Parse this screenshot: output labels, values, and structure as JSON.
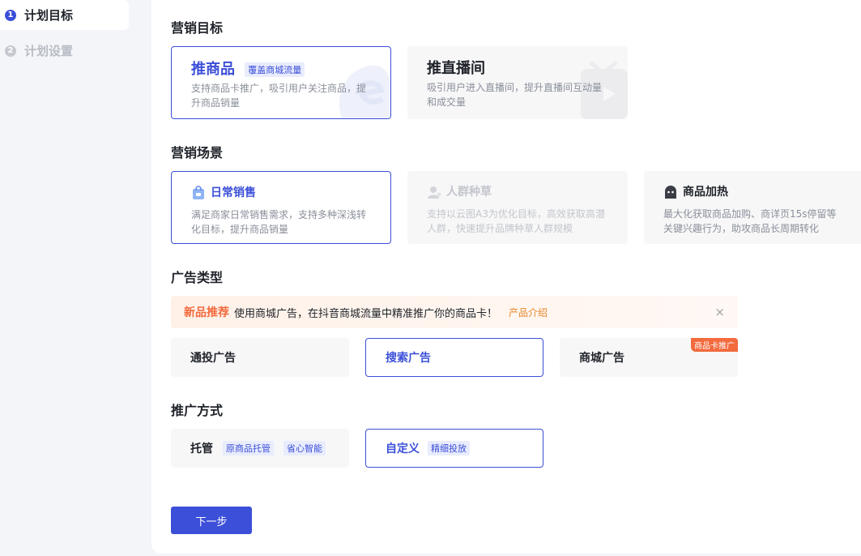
{
  "sidebar": {
    "steps": [
      {
        "num": "1",
        "label": "计划目标"
      },
      {
        "num": "2",
        "label": "计划设置"
      }
    ]
  },
  "marketing_goal": {
    "title": "营销目标",
    "cards": [
      {
        "title": "推商品",
        "tag": "覆盖商城流量",
        "desc_line1": "支持商品卡推广，吸引用户关注商品，提",
        "desc_line2": "升商品销量"
      },
      {
        "title": "推直播间",
        "desc_line1": "吸引用户进入直播间，提升直播间互动量",
        "desc_line2": "和成交量"
      }
    ]
  },
  "marketing_scene": {
    "title": "营销场景",
    "cards": [
      {
        "title": "日常销售",
        "desc_line1": "满足商家日常销售需求，支持多种深浅转",
        "desc_line2": "化目标，提升商品销量",
        "icon": "shopping-bag-icon"
      },
      {
        "title": "人群种草",
        "desc_line1": "支持以云图A3为优化目标，高效获取高潜",
        "desc_line2": "人群，快速提升品牌种草人群规模",
        "icon": "person-icon"
      },
      {
        "title": "商品加热",
        "desc_line1": "最大化获取商品加购、商详页15s停留等",
        "desc_line2": "关键兴趣行为，助攻商品长周期转化",
        "icon": "ghost-icon"
      }
    ]
  },
  "ad_type": {
    "title": "广告类型",
    "banner": {
      "highlight": "新品推荐",
      "text": "使用商城广告，在抖音商城流量中精准推广你的商品卡！",
      "link": "产品介绍",
      "close": "×"
    },
    "options": [
      {
        "label": "通投广告"
      },
      {
        "label": "搜索广告"
      },
      {
        "label": "商城广告",
        "corner": "商品卡推广"
      }
    ]
  },
  "promo_method": {
    "title": "推广方式",
    "options": [
      {
        "label": "托管",
        "tags": [
          "原商品托管",
          "省心智能"
        ]
      },
      {
        "label": "自定义",
        "tags": [
          "精细投放"
        ]
      }
    ]
  },
  "actions": {
    "next": "下一步"
  },
  "colors": {
    "accent": "#3c4fd8",
    "orange": "#f26a3d"
  }
}
